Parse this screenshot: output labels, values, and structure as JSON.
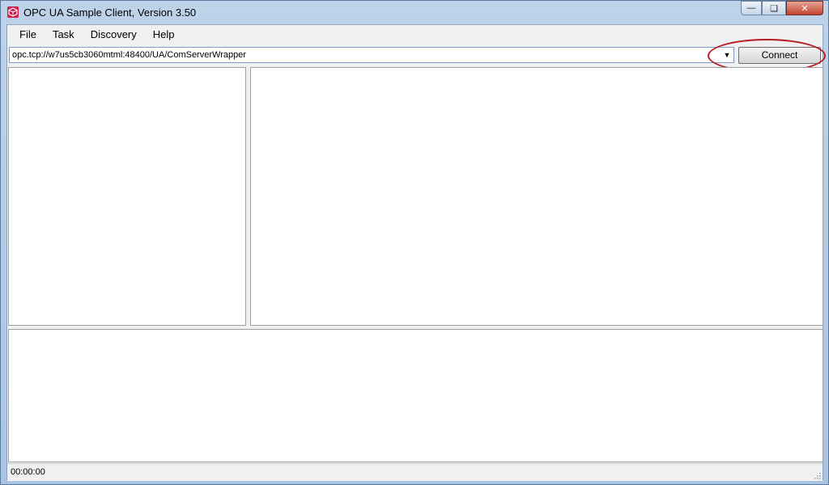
{
  "window": {
    "title": "OPC UA Sample Client, Version 3.50"
  },
  "menu": {
    "items": [
      "File",
      "Task",
      "Discovery",
      "Help"
    ]
  },
  "address": {
    "value": "opc.tcp://w7us5cb3060mtml:48400/UA/ComServerWrapper"
  },
  "connect": {
    "label": "Connect"
  },
  "status": {
    "time": "00:00:00"
  },
  "colors": {
    "highlight": "#b81c22",
    "accent": "#d11a4a"
  }
}
